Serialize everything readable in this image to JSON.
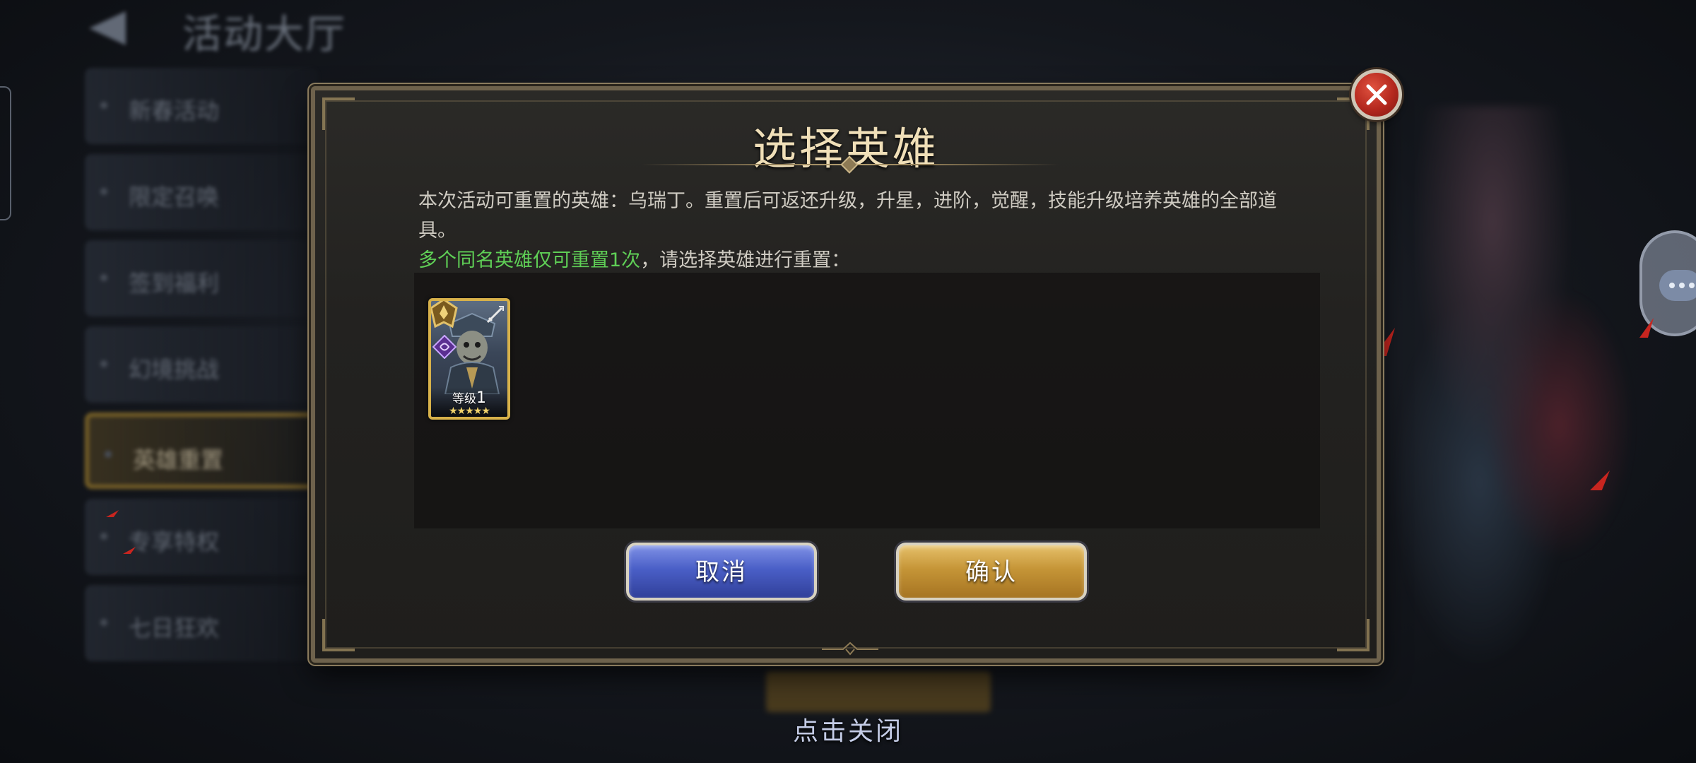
{
  "background": {
    "header_title": "活动大厅",
    "menu_items": [
      {
        "label": "新春活动"
      },
      {
        "label": "限定召唤"
      },
      {
        "label": "签到福利"
      },
      {
        "label": "幻境挑战"
      },
      {
        "label": "英雄重置"
      },
      {
        "label": "专享特权"
      },
      {
        "label": "七日狂欢"
      }
    ]
  },
  "modal": {
    "title": "选择英雄",
    "desc_line1": "本次活动可重置的英雄：乌瑞丁。重置后可返还升级，升星，进阶，觉醒，技能升级培养英雄的全部道具。",
    "desc_line2_green": "多个同名英雄仅可重置1次",
    "desc_line2_rest": "，请选择英雄进行重置：",
    "hero": {
      "level_label": "等级",
      "level_value": "1",
      "stars": "★★★★★",
      "class_icon": "class-badge-icon",
      "weapon_icon": "sword-icon",
      "element_icon": "void-element-icon"
    },
    "cancel_label": "取消",
    "confirm_label": "确认"
  },
  "tap_to_close": "点击关闭",
  "colors": {
    "title": "#f0dfb8",
    "highlight_green": "#5fcf56",
    "cancel_blue": "#4a5fc7",
    "confirm_gold": "#c59537",
    "close_red": "#b4281e"
  }
}
